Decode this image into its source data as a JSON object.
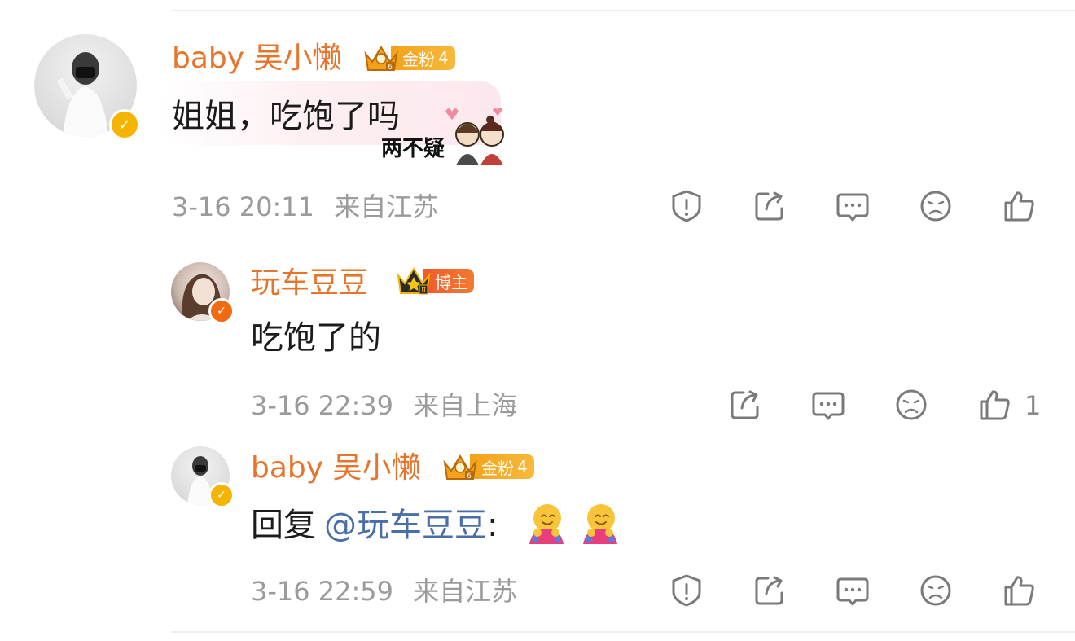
{
  "comments": [
    {
      "user": "baby 吴小懒",
      "fan_badge": "金粉",
      "fan_level": "4",
      "text": "姐姐，吃饱了吗",
      "sticker_text": "两不疑",
      "time": "3-16 20:11",
      "location": "来自江苏",
      "actions": [
        "report-icon",
        "share-icon",
        "comment-icon",
        "dislike-icon",
        "like-icon"
      ]
    },
    {
      "user": "玩车豆豆",
      "host_badge": "博主",
      "text": "吃饱了的",
      "time": "3-16 22:39",
      "location": "来自上海",
      "actions": [
        "share-icon",
        "comment-icon",
        "dislike-icon",
        "like-icon"
      ],
      "like_count": "1"
    },
    {
      "user": "baby 吴小懒",
      "fan_badge": "金粉",
      "fan_level": "4",
      "reply_prefix": "回复",
      "mention": "@玩车豆豆",
      "reply_colon": ":",
      "emoji": "hug-emoji",
      "time": "3-16 22:59",
      "location": "来自江苏",
      "actions": [
        "report-icon",
        "share-icon",
        "comment-icon",
        "dislike-icon",
        "like-icon"
      ]
    }
  ],
  "colors": {
    "username": "#e8742b",
    "mention": "#496ea8",
    "meta": "#9b9b9b",
    "verified_gold": "#f5b400",
    "verified_orange": "#f26a12"
  }
}
